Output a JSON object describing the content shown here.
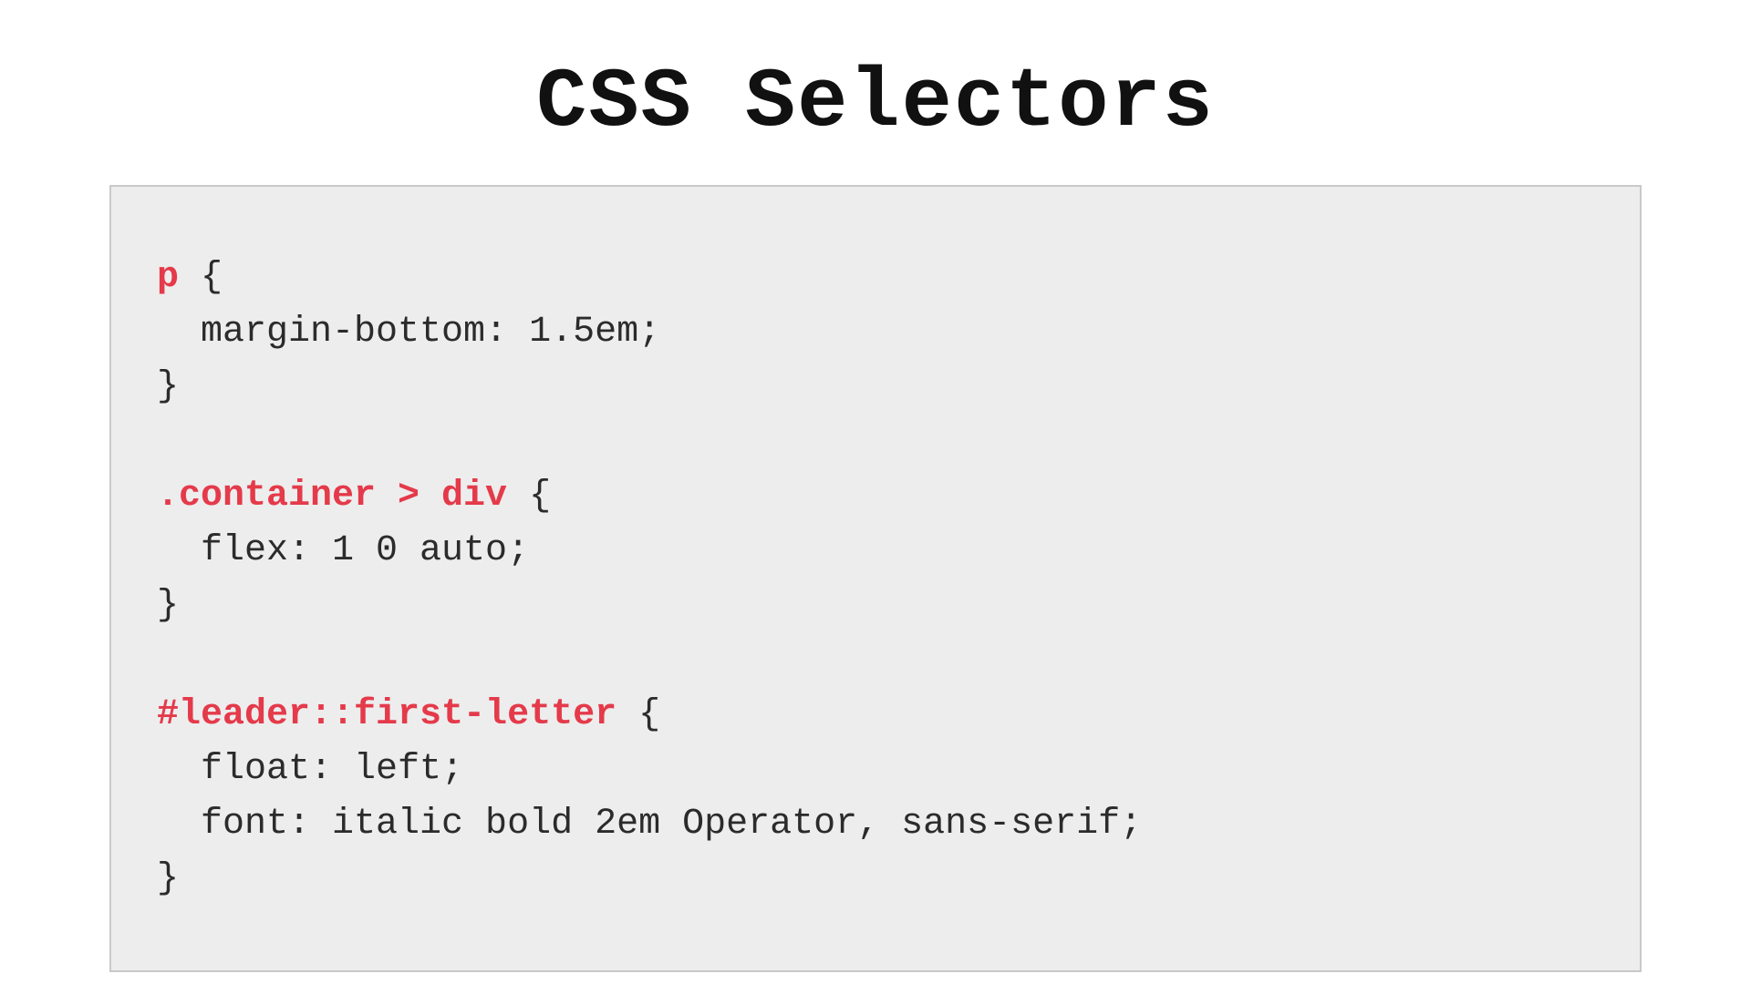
{
  "title": "CSS Selectors",
  "colors": {
    "selector": "#e43a4a",
    "body": "#2b2b2b",
    "codebox_bg": "#ededed",
    "codebox_border": "#c9c9c9"
  },
  "code": {
    "rules": [
      {
        "selector": "p",
        "open": " {",
        "declarations": [
          "  margin-bottom: 1.5em;"
        ],
        "close": "}"
      },
      {
        "selector": ".container > div",
        "open": " {",
        "declarations": [
          "  flex: 1 0 auto;"
        ],
        "close": "}"
      },
      {
        "selector": "#leader::first-letter",
        "open": " {",
        "declarations": [
          "  float: left;",
          "  font: italic bold 2em Operator, sans-serif;"
        ],
        "close": "}"
      }
    ]
  }
}
